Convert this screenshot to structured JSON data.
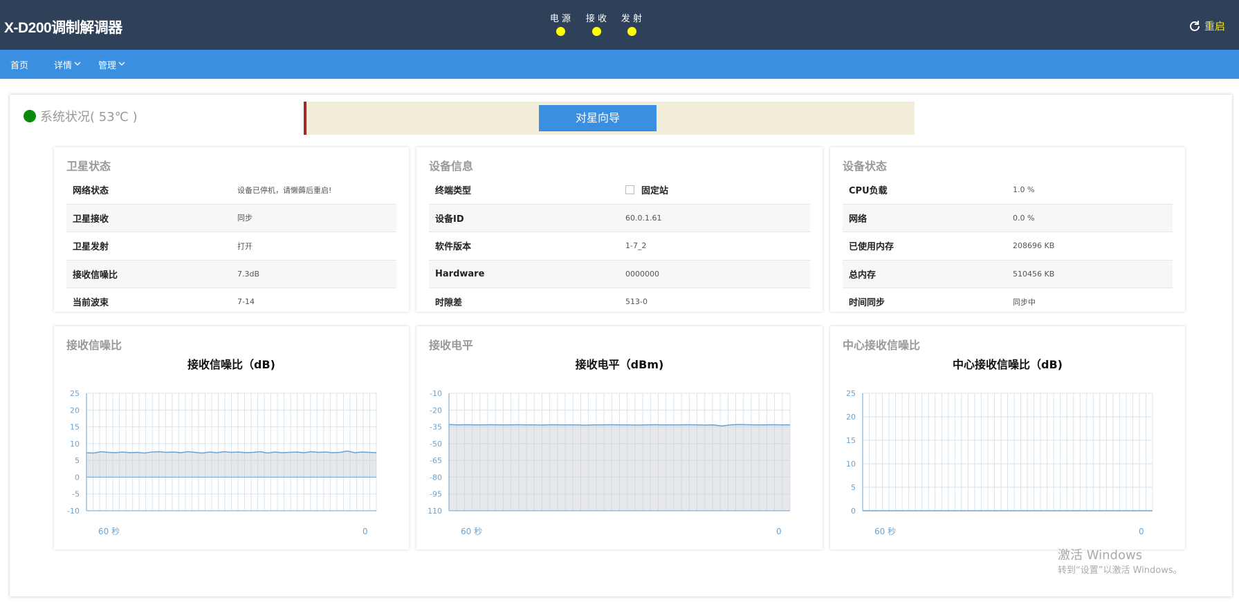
{
  "app": {
    "title": "X-D200调制解调器",
    "indicators": [
      {
        "label": "电 源",
        "color": "#ffff00"
      },
      {
        "label": "接 收",
        "color": "#ffff00"
      },
      {
        "label": "发 射",
        "color": "#ffff00"
      }
    ],
    "restart_label": "重启"
  },
  "nav": {
    "home": "首页",
    "details": "详情",
    "manage": "管理"
  },
  "status": {
    "label": "系统状况( 53℃ )",
    "status_color": "#0a8a0a"
  },
  "guide_button": "对星向导",
  "satellite": {
    "title": "卫星状态",
    "rows": [
      {
        "k": "网络状态",
        "v": "设备已停机，请懒薅后重启!"
      },
      {
        "k": "卫星接收",
        "v": "同步"
      },
      {
        "k": "卫星发射",
        "v": "打开"
      },
      {
        "k": "接收信噪比",
        "v": "7.3dB"
      },
      {
        "k": "当前波束",
        "v": "7-14"
      }
    ]
  },
  "device_info": {
    "title": "设备信息",
    "rows": [
      {
        "k": "终端类型",
        "v": "固定站"
      },
      {
        "k": "设备ID",
        "v": "60.0.1.61"
      },
      {
        "k": "软件版本",
        "v": "1-7_2"
      },
      {
        "k": "Hardware",
        "v": "0000000"
      },
      {
        "k": "时隙差",
        "v": "513-0"
      }
    ]
  },
  "device_status": {
    "title": "设备状态",
    "rows": [
      {
        "k": "CPU负载",
        "v": "1.0 %"
      },
      {
        "k": "网络",
        "v": "0.0 %"
      },
      {
        "k": "已使用内存",
        "v": "208696 KB"
      },
      {
        "k": "总内存",
        "v": "510456 KB"
      },
      {
        "k": "时间同步",
        "v": "同步中"
      }
    ]
  },
  "chart_panels": [
    {
      "panel_title": "接收信噪比"
    },
    {
      "panel_title": "接收电平"
    },
    {
      "panel_title": "中心接收信噪比"
    }
  ],
  "chart_data": [
    {
      "type": "area",
      "title": "接收信噪比（dB)",
      "x_start_label": "60 秒",
      "x_end_label": "0",
      "yticks": [
        25,
        20,
        15,
        10,
        5,
        0,
        -5,
        -10
      ],
      "ylim": [
        -10,
        25
      ],
      "baseline": 0,
      "values": [
        7.3,
        7.2,
        7.6,
        7.4,
        7.3,
        7.5,
        7.3,
        7.4,
        7.2,
        7.5,
        7.6,
        7.4,
        7.5,
        7.3,
        7.6,
        7.4,
        7.2,
        7.5,
        7.3,
        7.6,
        7.4,
        7.5,
        7.3,
        7.4,
        7.6,
        7.2,
        7.5,
        7.3,
        7.4,
        7.5,
        7.3,
        7.6,
        7.4,
        7.5,
        7.3,
        7.4,
        7.8,
        7.3,
        7.5,
        7.4,
        7.3
      ],
      "color": "#6aa3d1"
    },
    {
      "type": "area",
      "title": "接收电平（dBm)",
      "x_start_label": "60 秒",
      "x_end_label": "0",
      "yticks": [
        -10,
        -20,
        -35,
        -50,
        -65,
        -80,
        -95,
        110
      ],
      "ylim": [
        -110,
        -10
      ],
      "baseline": -110,
      "values": [
        -33,
        -33.2,
        -33.1,
        -33.3,
        -33.2,
        -33.1,
        -33.3,
        -33.2,
        -33.1,
        -33.3,
        -33.2,
        -33.4,
        -33.1,
        -33.2,
        -33.3,
        -33.2,
        -33.5,
        -33.3,
        -33.2,
        -33.1,
        -33.3,
        -33.2,
        -33.4,
        -33.3,
        -33.1,
        -33.2,
        -33.3,
        -33.2,
        -33.1,
        -33.3,
        -33.4,
        -33.2,
        -34.2,
        -33.2,
        -33.0,
        -33.1,
        -33.3,
        -33.2,
        -33.1,
        -33.2,
        -33.3
      ],
      "color": "#6aa3d1"
    },
    {
      "type": "area",
      "title": "中心接收信噪比（dB)",
      "x_start_label": "60 秒",
      "x_end_label": "0",
      "yticks": [
        25,
        20,
        15,
        10,
        5,
        0
      ],
      "ylim": [
        0,
        25
      ],
      "baseline": 0,
      "values": [
        0,
        0,
        0,
        0,
        0,
        0,
        0,
        0,
        0,
        0,
        0,
        0,
        0,
        0,
        0,
        0,
        0,
        0,
        0,
        0,
        0,
        0,
        0,
        0,
        0,
        0,
        0,
        0,
        0,
        0,
        0,
        0,
        0,
        0,
        0,
        0,
        0,
        0,
        0,
        0,
        0
      ],
      "color": "#6aa3d1"
    }
  ],
  "watermark": {
    "line1": "激活 Windows",
    "line2": "转到“设置”以激活 Windows。"
  }
}
